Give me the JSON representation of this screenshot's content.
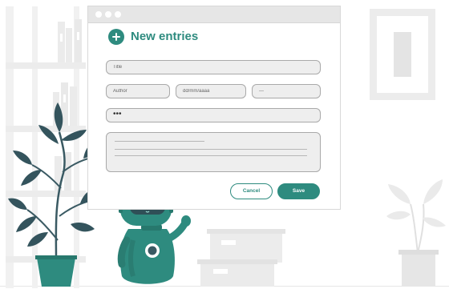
{
  "form": {
    "title": "New entries",
    "fields": {
      "title_placeholder": "Title",
      "author_placeholder": "Author",
      "date_placeholder": "dd/mm/aaaa",
      "select_value": "---",
      "password_value": "•••"
    },
    "buttons": {
      "cancel_label": "Cancel",
      "save_label": "Save"
    }
  },
  "icons": {
    "header": "plus-circle-icon"
  },
  "colors": {
    "accent": "#2e8b7f",
    "field_bg": "#eeeeee",
    "field_border": "#a9a9a9",
    "titlebar": "#e6e6e6",
    "background_illustration": "#f2f2f2"
  }
}
